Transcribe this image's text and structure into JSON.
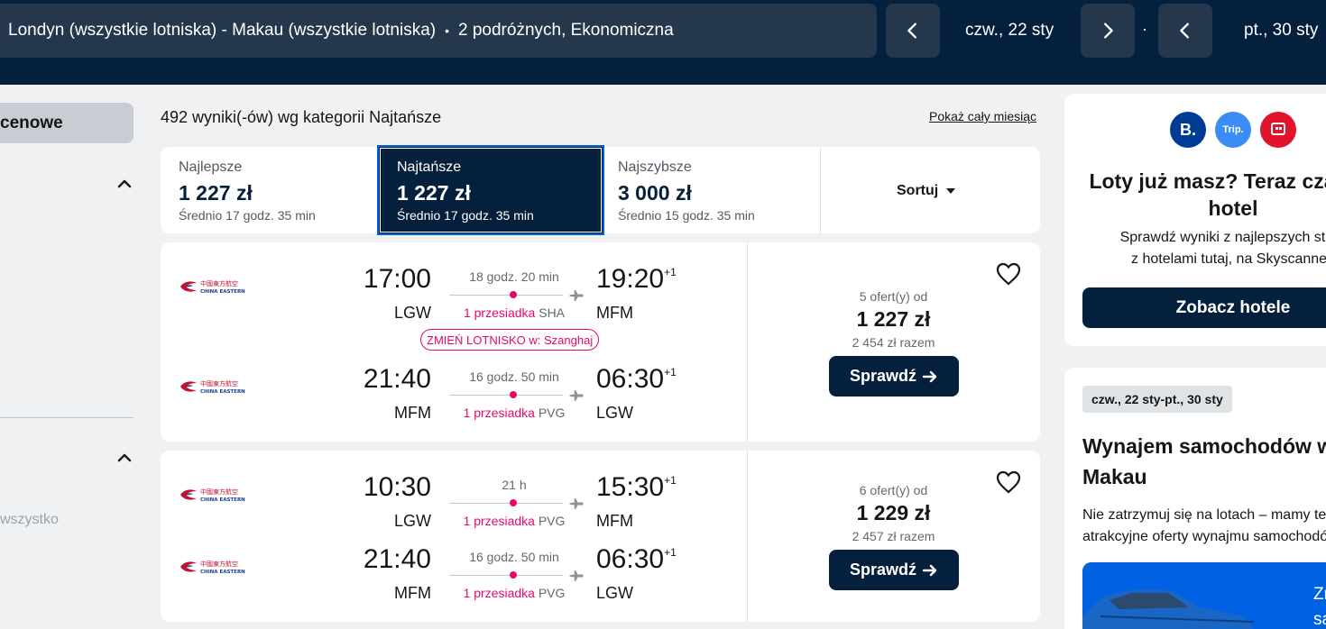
{
  "header": {
    "route": "Londyn (wszystkie lotniska) - Makau (wszystkie lotniska)",
    "separator": "•",
    "travellers": "2 podróżnych, Ekonomiczna",
    "depart_date": "czw., 22 sty",
    "date_separator": "·",
    "return_date": "pt., 30 sty"
  },
  "sidebar": {
    "pill_label": "cenowe",
    "bottom_text": "wszystko"
  },
  "results": {
    "count_text": "492 wyniki(-ów) wg kategorii Najtańsze",
    "show_month": "Pokaż cały miesiąc"
  },
  "tabs": [
    {
      "label": "Najlepsze",
      "price": "1 227 zł",
      "sub": "Średnio 17 godz. 35 min"
    },
    {
      "label": "Najtańsze",
      "price": "1 227 zł",
      "sub": "Średnio 17 godz. 35 min"
    },
    {
      "label": "Najszybsze",
      "price": "3 000 zł",
      "sub": "Średnio 15 godz. 35 min"
    }
  ],
  "sort_label": "Sortuj",
  "cards": [
    {
      "legs": [
        {
          "dep_time": "17:00",
          "dep_code": "LGW",
          "duration": "18 godz. 20 min",
          "stops": "1 przesiadka",
          "via": "SHA",
          "arr_time": "19:20",
          "arr_plus": "+1",
          "arr_code": "MFM"
        },
        {
          "dep_time": "21:40",
          "dep_code": "MFM",
          "duration": "16 godz. 50 min",
          "stops": "1 przesiadka",
          "via": "PVG",
          "arr_time": "06:30",
          "arr_plus": "+1",
          "arr_code": "LGW"
        }
      ],
      "change_airport": "ZMIEŃ LOTNISKO w: Szanghaj",
      "offers": "5 ofert(y) od",
      "price": "1 227 zł",
      "total": "2 454 zł razem",
      "button": "Sprawdź"
    },
    {
      "legs": [
        {
          "dep_time": "10:30",
          "dep_code": "LGW",
          "duration": "21 h",
          "stops": "1 przesiadka",
          "via": "PVG",
          "arr_time": "15:30",
          "arr_plus": "+1",
          "arr_code": "MFM"
        },
        {
          "dep_time": "21:40",
          "dep_code": "MFM",
          "duration": "16 godz. 50 min",
          "stops": "1 przesiadka",
          "via": "PVG",
          "arr_time": "06:30",
          "arr_plus": "+1",
          "arr_code": "LGW"
        }
      ],
      "offers": "6 ofert(y) od",
      "price": "1 229 zł",
      "total": "2 457 zł razem",
      "button": "Sprawdź"
    }
  ],
  "airline_logo_text": {
    "cn": "中國東方航空",
    "en": "CHINA EASTERN"
  },
  "promo": {
    "partners": [
      "B.",
      "Trip.",
      ""
    ],
    "title_line1": "Loty już masz? Teraz czas na",
    "title_line2": "hotel",
    "text_line1": "Sprawdź wyniki z najlepszych stron",
    "text_line2": "z hotelami tutaj, na Skyscanner.",
    "button": "Zobacz hotele"
  },
  "car": {
    "dates": "czw., 22 sty-pt., 30 sty",
    "title_line1": "Wynajem samochodów w",
    "title_line2": "Makau",
    "text_line1": "Nie zatrzymuj się na lotach – mamy też",
    "text_line2": "atrakcyjne oferty wynajmu samochodów.",
    "banner_line1": "Zn",
    "banner_line2": "samo"
  },
  "colors": {
    "navy": "#05203c",
    "pink": "#e70866",
    "blue": "#0062e3"
  }
}
